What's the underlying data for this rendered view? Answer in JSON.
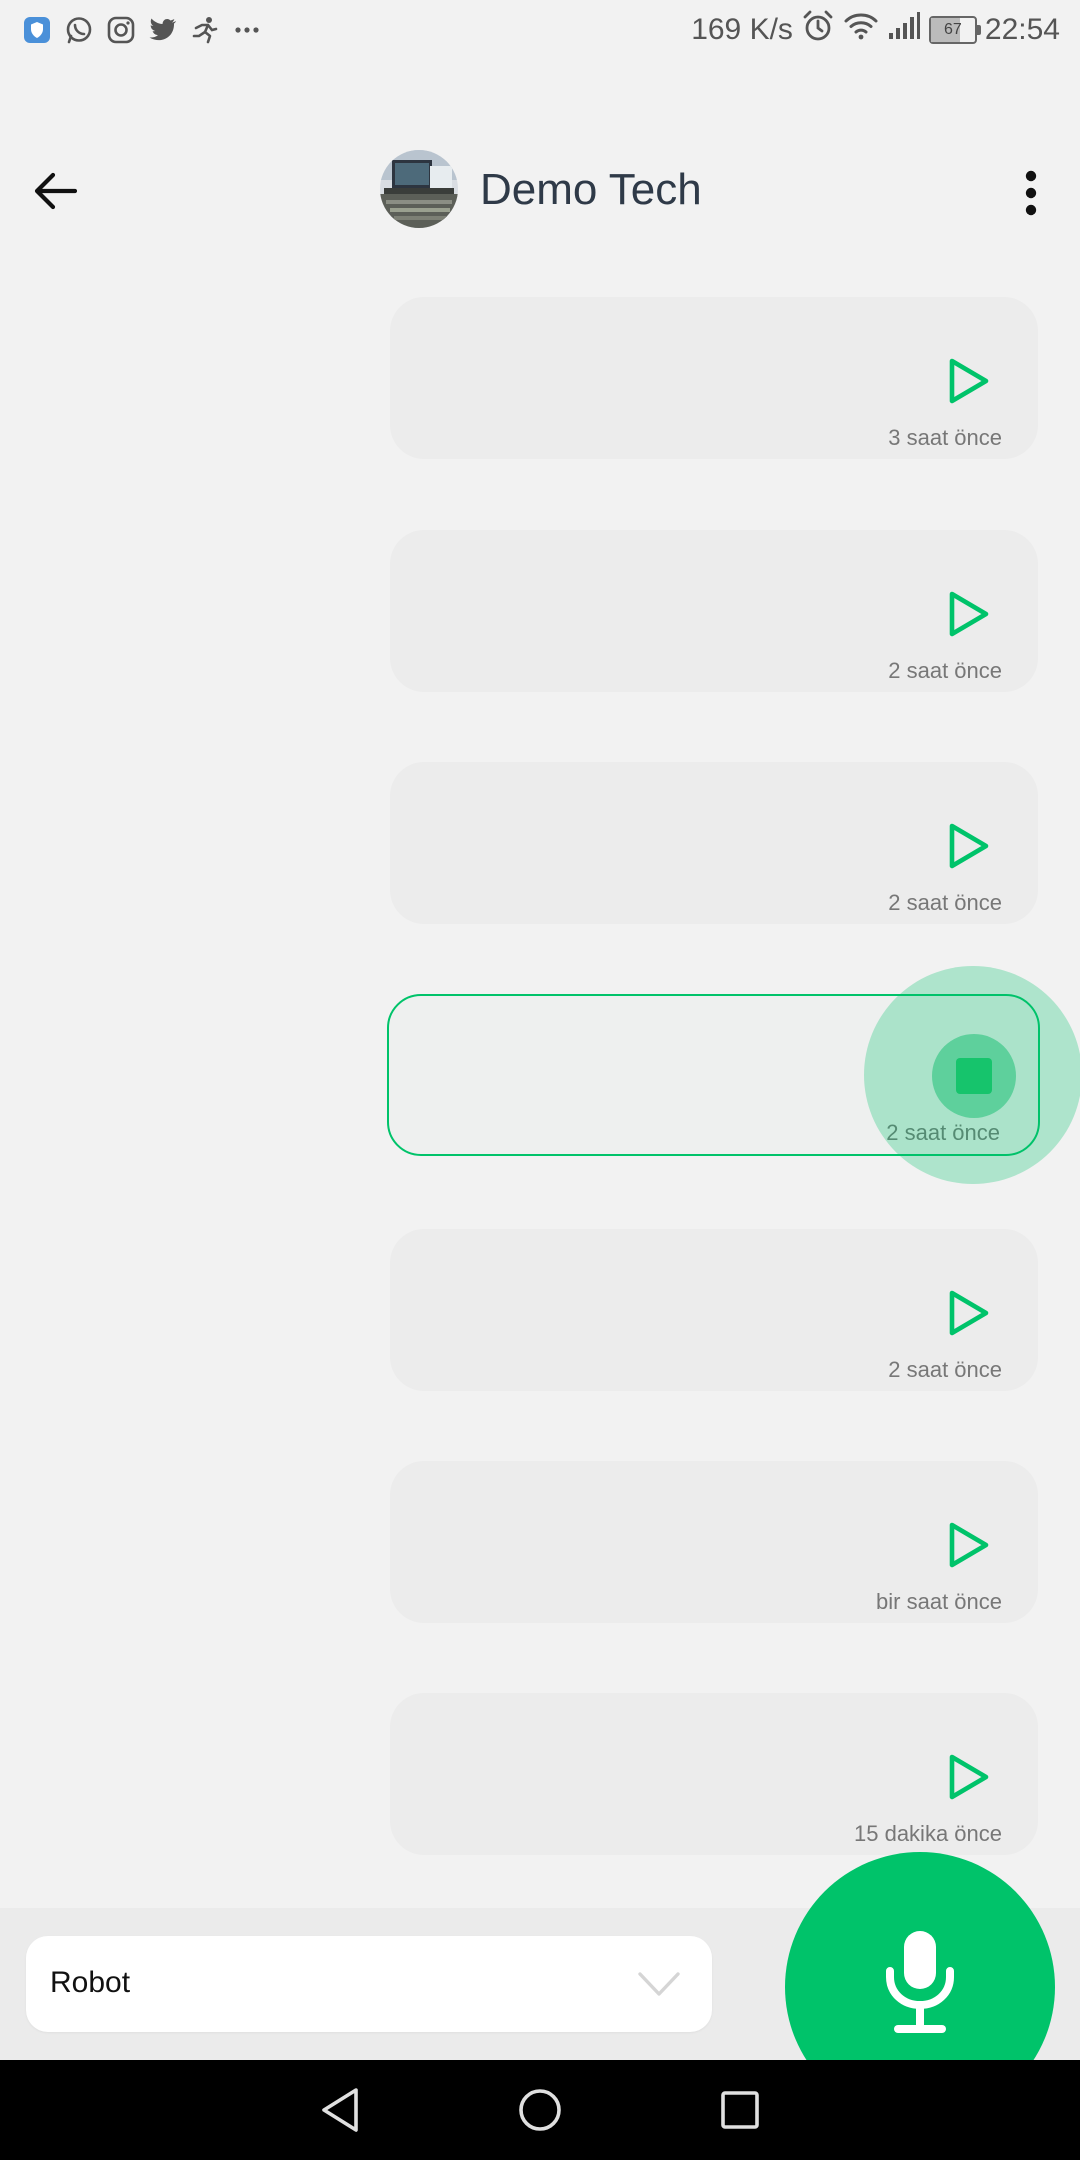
{
  "status_bar": {
    "speed": "169 K/s",
    "battery": "67",
    "battery_level": 0.67,
    "time": "22:54",
    "notification_icons": [
      "shield-icon",
      "whatsapp-icon",
      "instagram-icon",
      "twitter-icon",
      "running-icon",
      "more-dots-icon"
    ]
  },
  "header": {
    "title": "Demo Tech",
    "back_icon": "arrow-left-icon",
    "menu_icon": "more-vertical-icon"
  },
  "messages": [
    {
      "timestamp": "3 saat önce",
      "state": "idle"
    },
    {
      "timestamp": "2 saat önce",
      "state": "idle"
    },
    {
      "timestamp": "2 saat önce",
      "state": "idle"
    },
    {
      "timestamp": "2 saat önce",
      "state": "playing"
    },
    {
      "timestamp": "2 saat önce",
      "state": "idle"
    },
    {
      "timestamp": "bir saat önce",
      "state": "idle"
    },
    {
      "timestamp": "15 dakika önce",
      "state": "idle"
    }
  ],
  "voice_select": {
    "value": "Robot"
  },
  "colors": {
    "accent": "#00c36a",
    "background": "#f2f2f2",
    "bubble": "#ececec",
    "title": "#2f3a48"
  }
}
